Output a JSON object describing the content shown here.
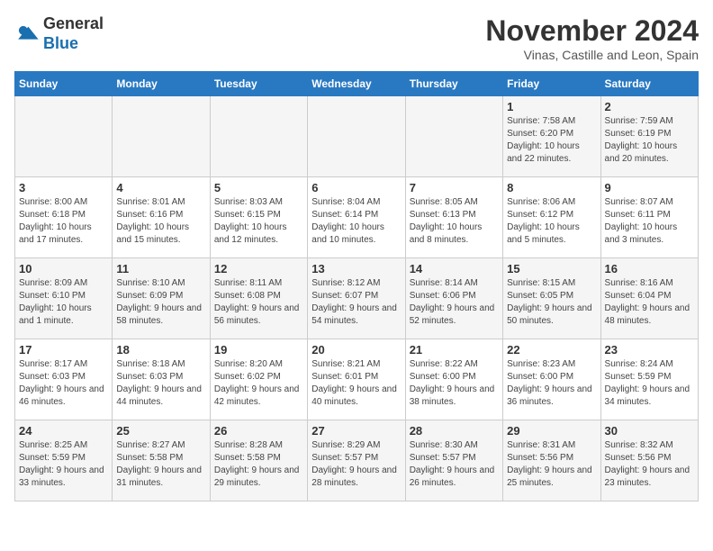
{
  "logo": {
    "line1": "General",
    "line2": "Blue"
  },
  "header": {
    "month": "November 2024",
    "location": "Vinas, Castille and Leon, Spain"
  },
  "weekdays": [
    "Sunday",
    "Monday",
    "Tuesday",
    "Wednesday",
    "Thursday",
    "Friday",
    "Saturday"
  ],
  "weeks": [
    [
      {
        "day": "",
        "info": ""
      },
      {
        "day": "",
        "info": ""
      },
      {
        "day": "",
        "info": ""
      },
      {
        "day": "",
        "info": ""
      },
      {
        "day": "",
        "info": ""
      },
      {
        "day": "1",
        "info": "Sunrise: 7:58 AM\nSunset: 6:20 PM\nDaylight: 10 hours and 22 minutes."
      },
      {
        "day": "2",
        "info": "Sunrise: 7:59 AM\nSunset: 6:19 PM\nDaylight: 10 hours and 20 minutes."
      }
    ],
    [
      {
        "day": "3",
        "info": "Sunrise: 8:00 AM\nSunset: 6:18 PM\nDaylight: 10 hours and 17 minutes."
      },
      {
        "day": "4",
        "info": "Sunrise: 8:01 AM\nSunset: 6:16 PM\nDaylight: 10 hours and 15 minutes."
      },
      {
        "day": "5",
        "info": "Sunrise: 8:03 AM\nSunset: 6:15 PM\nDaylight: 10 hours and 12 minutes."
      },
      {
        "day": "6",
        "info": "Sunrise: 8:04 AM\nSunset: 6:14 PM\nDaylight: 10 hours and 10 minutes."
      },
      {
        "day": "7",
        "info": "Sunrise: 8:05 AM\nSunset: 6:13 PM\nDaylight: 10 hours and 8 minutes."
      },
      {
        "day": "8",
        "info": "Sunrise: 8:06 AM\nSunset: 6:12 PM\nDaylight: 10 hours and 5 minutes."
      },
      {
        "day": "9",
        "info": "Sunrise: 8:07 AM\nSunset: 6:11 PM\nDaylight: 10 hours and 3 minutes."
      }
    ],
    [
      {
        "day": "10",
        "info": "Sunrise: 8:09 AM\nSunset: 6:10 PM\nDaylight: 10 hours and 1 minute."
      },
      {
        "day": "11",
        "info": "Sunrise: 8:10 AM\nSunset: 6:09 PM\nDaylight: 9 hours and 58 minutes."
      },
      {
        "day": "12",
        "info": "Sunrise: 8:11 AM\nSunset: 6:08 PM\nDaylight: 9 hours and 56 minutes."
      },
      {
        "day": "13",
        "info": "Sunrise: 8:12 AM\nSunset: 6:07 PM\nDaylight: 9 hours and 54 minutes."
      },
      {
        "day": "14",
        "info": "Sunrise: 8:14 AM\nSunset: 6:06 PM\nDaylight: 9 hours and 52 minutes."
      },
      {
        "day": "15",
        "info": "Sunrise: 8:15 AM\nSunset: 6:05 PM\nDaylight: 9 hours and 50 minutes."
      },
      {
        "day": "16",
        "info": "Sunrise: 8:16 AM\nSunset: 6:04 PM\nDaylight: 9 hours and 48 minutes."
      }
    ],
    [
      {
        "day": "17",
        "info": "Sunrise: 8:17 AM\nSunset: 6:03 PM\nDaylight: 9 hours and 46 minutes."
      },
      {
        "day": "18",
        "info": "Sunrise: 8:18 AM\nSunset: 6:03 PM\nDaylight: 9 hours and 44 minutes."
      },
      {
        "day": "19",
        "info": "Sunrise: 8:20 AM\nSunset: 6:02 PM\nDaylight: 9 hours and 42 minutes."
      },
      {
        "day": "20",
        "info": "Sunrise: 8:21 AM\nSunset: 6:01 PM\nDaylight: 9 hours and 40 minutes."
      },
      {
        "day": "21",
        "info": "Sunrise: 8:22 AM\nSunset: 6:00 PM\nDaylight: 9 hours and 38 minutes."
      },
      {
        "day": "22",
        "info": "Sunrise: 8:23 AM\nSunset: 6:00 PM\nDaylight: 9 hours and 36 minutes."
      },
      {
        "day": "23",
        "info": "Sunrise: 8:24 AM\nSunset: 5:59 PM\nDaylight: 9 hours and 34 minutes."
      }
    ],
    [
      {
        "day": "24",
        "info": "Sunrise: 8:25 AM\nSunset: 5:59 PM\nDaylight: 9 hours and 33 minutes."
      },
      {
        "day": "25",
        "info": "Sunrise: 8:27 AM\nSunset: 5:58 PM\nDaylight: 9 hours and 31 minutes."
      },
      {
        "day": "26",
        "info": "Sunrise: 8:28 AM\nSunset: 5:58 PM\nDaylight: 9 hours and 29 minutes."
      },
      {
        "day": "27",
        "info": "Sunrise: 8:29 AM\nSunset: 5:57 PM\nDaylight: 9 hours and 28 minutes."
      },
      {
        "day": "28",
        "info": "Sunrise: 8:30 AM\nSunset: 5:57 PM\nDaylight: 9 hours and 26 minutes."
      },
      {
        "day": "29",
        "info": "Sunrise: 8:31 AM\nSunset: 5:56 PM\nDaylight: 9 hours and 25 minutes."
      },
      {
        "day": "30",
        "info": "Sunrise: 8:32 AM\nSunset: 5:56 PM\nDaylight: 9 hours and 23 minutes."
      }
    ]
  ]
}
